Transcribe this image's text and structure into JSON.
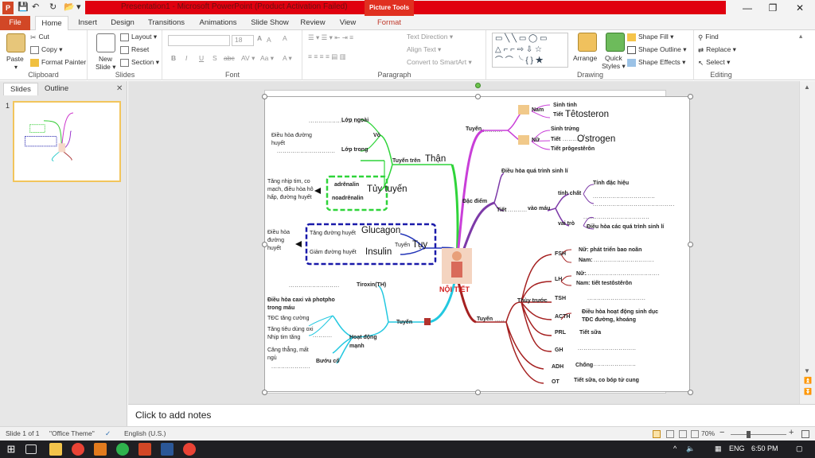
{
  "window": {
    "title": "Presentation1 - Microsoft PowerPoint (Product Activation Failed)",
    "context_tab": "Picture Tools",
    "minimize": "—",
    "restore": "❐",
    "close": "✕"
  },
  "tabs": [
    "File",
    "Home",
    "Insert",
    "Design",
    "Transitions",
    "Animations",
    "Slide Show",
    "Review",
    "View",
    "Format"
  ],
  "ribbon": {
    "clipboard": {
      "paste": "Paste",
      "cut": "Cut",
      "copy": "Copy ▾",
      "format_painter": "Format Painter",
      "label": "Clipboard"
    },
    "slides": {
      "new_slide": "New",
      "new_slide2": "Slide ▾",
      "layout": "Layout ▾",
      "reset": "Reset",
      "section": "Section ▾",
      "label": "Slides"
    },
    "font": {
      "size": "18",
      "label": "Font",
      "bold": "B",
      "italic": "I",
      "underline": "U",
      "shadow": "S",
      "strike": "abc",
      "spacing": "AV ▾",
      "case": "Aa ▾",
      "grow": "A",
      "shrink": "A",
      "clear": "A",
      "color": "A ▾"
    },
    "paragraph": {
      "text_direction": "Text Direction ▾",
      "align_text": "Align Text ▾",
      "smartart": "Convert to SmartArt ▾",
      "label": "Paragraph"
    },
    "drawing": {
      "arrange": "Arrange",
      "quick_styles": "Quick",
      "quick_styles2": "Styles ▾",
      "shape_fill": "Shape Fill ▾",
      "shape_outline": "Shape Outline ▾",
      "shape_effects": "Shape Effects ▾",
      "label": "Drawing"
    },
    "editing": {
      "find": "Find",
      "replace": "Replace ▾",
      "select": "Select ▾",
      "label": "Editing"
    }
  },
  "left_pane": {
    "tab_slides": "Slides",
    "tab_outline": "Outline",
    "close": "✕",
    "slide_number": "1"
  },
  "slide": {
    "center": "NỘI TIẾT",
    "left": {
      "lop_ngoai": "Lớp ngoài",
      "lop_trong": "Lớp trong",
      "vo": "Vỏ",
      "dieu_hoa_duong_huyet1": "Điều hòa đường",
      "dieu_hoa_duong_huyet2": "huyết",
      "tuyen_tren": "Tuyến trên",
      "than": "Thận",
      "adrenalin": "adrênalin",
      "noadrenalin": "noadrênalin",
      "tuy_tuyen": "Tủy tuyến",
      "tang_nhip1": "Tăng nhịp tim, co",
      "tang_nhip2": "mạch, điều hòa hô",
      "tang_nhip3": "hấp, đường huyết",
      "dhdh_a": "Điều hòa",
      "dhdh_b": "đường",
      "dhdh_c": "huyết",
      "tang_duong_huyet": "Tăng đường huyết",
      "giam_duong_huyet": "Giảm đường huyết",
      "glucagon": "Glucagon",
      "insulin": "Insulin",
      "tuyen_tuy": "Tuyến",
      "tuy": "Tụy",
      "tiroxin": "Tiroxin(TH)",
      "caxi1": "Điều hòa caxi và photpho",
      "caxi2": "trong máu",
      "tdc": "TĐC tăng cường",
      "tang_tieu1": "Tăng tiêu dùng oxi",
      "tang_tieu2": "Nhịp tim tăng",
      "cang_thang1": "Căng thẳng, mất",
      "cang_thang2": "ngủ",
      "hoat_dong1": "Hoạt động",
      "hoat_dong2": "mạnh",
      "buou_co": "Bướu cổ",
      "tuyen_giap": "Tuyến"
    },
    "right": {
      "tuyen_sd": "Tuyến",
      "nam": "Nam",
      "sinh_tinh": "Sinh tinh",
      "tiet_nam": "Tiết",
      "testosteron": "Têtosteron",
      "nu": "Nữ",
      "sinh_trung": "Sinh trứng",
      "tiet_nu": "Tiết",
      "ostrogen": "Ơstrogen",
      "tiet_progesteron": "Tiết prôgestêrôn",
      "dac_diem": "Đặc điểm",
      "dieu_hoa_qtsl": "Điều hòa quá trình sinh lí",
      "tiet": "Tiết",
      "vao_mau": "vào máu",
      "tinh_chat": "tính chất",
      "tinh_dac_hieu": "Tính đặc hiệu",
      "vai_tro": "vai trò",
      "dieu_hoa_cac_qtsl": "Điều hòa các quá trình sinh lí",
      "fsh": "FSH",
      "fsh_nu": "Nữ: phát triển bao noãn",
      "fsh_nam": "Nam:",
      "lh": "LH",
      "lh_nu": "Nữ:",
      "lh_nam": "Nam: tiết testôstêrôn",
      "tsh": "TSH",
      "thuy_truoc": "Thùy trước",
      "acth": "ACTH",
      "acth_d1": "Điều hòa hoạt động sinh dục",
      "acth_d2": "TĐC đường, khoáng",
      "prl": "PRL",
      "tiet_sua": "Tiết sữa",
      "gh": "GH",
      "adh": "ADH",
      "chong": "Chống",
      "ot": "OT",
      "ot_d": "Tiết sữa, co bóp tử cung",
      "tuyen_yen": "Tuyến"
    }
  },
  "notes_placeholder": "Click to add notes",
  "status": {
    "slide_of": "Slide 1 of 1",
    "theme": "\"Office Theme\"",
    "language": "English (U.S.)",
    "zoom": "70%",
    "minus": "−",
    "plus": "+"
  },
  "taskbar": {
    "lang": "ENG",
    "time": "6:50 PM"
  },
  "colors": {
    "title_red": "#e0000f",
    "file_tab": "#d24726",
    "thumb_border": "#f2c55c"
  }
}
